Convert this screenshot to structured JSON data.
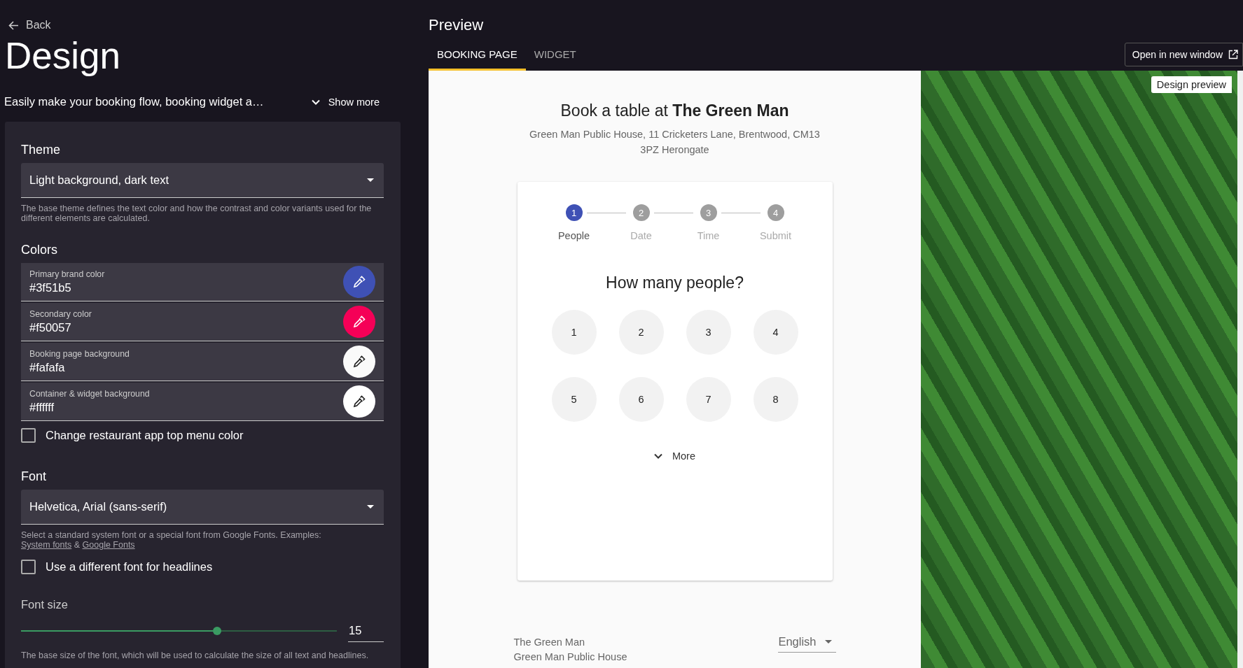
{
  "back": {
    "label": "Back"
  },
  "title": "Design",
  "description": {
    "text": "Easily make your booking flow, booking widget a…",
    "toggle": "Show more"
  },
  "theme": {
    "heading": "Theme",
    "value": "Light background, dark text",
    "help": "The base theme defines the text color and how the contrast and color variants used for the different elements are calculated."
  },
  "colors": {
    "heading": "Colors",
    "fields": [
      {
        "label": "Primary brand color",
        "value": "#3f51b5",
        "color": "#3f51b5"
      },
      {
        "label": "Secondary color",
        "value": "#f50057",
        "color": "#f50057"
      },
      {
        "label": "Booking page background",
        "value": "#fafafa",
        "color": "#fafafa"
      },
      {
        "label": "Container & widget background",
        "value": "#ffffff",
        "color": "#ffffff"
      }
    ],
    "checkbox": {
      "label": "Change restaurant app top menu color",
      "checked": false
    }
  },
  "font": {
    "heading": "Font",
    "value": "Helvetica, Arial (sans-serif)",
    "help": "Select a standard system font or a special font from Google Fonts. Examples:",
    "links": [
      "System fonts",
      "Google Fonts"
    ],
    "link_separator": "&",
    "checkbox": {
      "label": "Use a different font for headlines",
      "checked": false
    }
  },
  "font_size": {
    "heading": "Font size",
    "level": 0.62,
    "value": "15",
    "help": "The base size of the font, which will be used to calculate the size of all text and headlines."
  },
  "preview": {
    "title": "Preview",
    "tabs": [
      {
        "label": "BOOKING PAGE",
        "selected": true
      },
      {
        "label": "WIDGET",
        "selected": false
      }
    ],
    "open_button": "Open in new window",
    "badge": "Design preview",
    "booking": {
      "heading": "Book a table at **The Green Man**",
      "address": "Green Man Public House, 11 Cricketers Lane, Brentwood, CM13 3PZ Herongate",
      "steps": [
        {
          "number": "1",
          "label": "People",
          "selected": true
        },
        {
          "number": "2",
          "label": "Date",
          "selected": false
        },
        {
          "number": "3",
          "label": "Time",
          "selected": false
        },
        {
          "number": "4",
          "label": "Submit",
          "selected": false
        }
      ],
      "question": "How many people?",
      "party_sizes": [
        "1",
        "2",
        "3",
        "4",
        "5",
        "6",
        "7",
        "8"
      ],
      "more": "More",
      "footer": {
        "lines": [
          "The Green Man",
          "Green Man Public House"
        ],
        "language": "English"
      }
    }
  }
}
